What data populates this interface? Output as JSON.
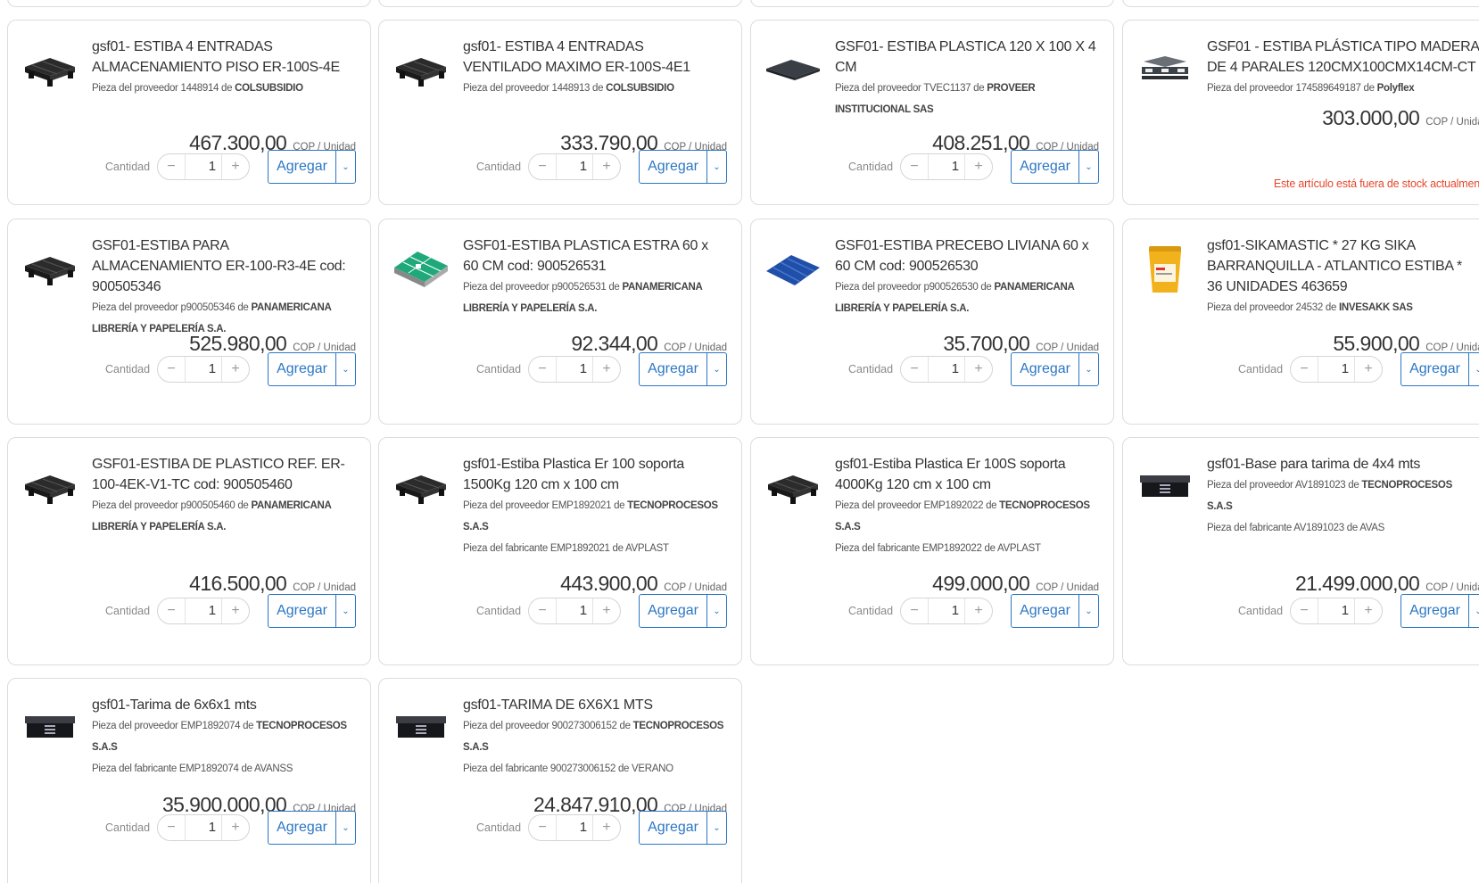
{
  "common": {
    "quantity_label": "Cantidad",
    "add_label": "Agregar",
    "unit_label": "COP / Unidad",
    "minus": "−",
    "plus": "+",
    "chevron": "⌄"
  },
  "colors": {
    "accent": "#2b77c4",
    "out_of_stock": "#e5472b",
    "border": "#dcdcdc"
  },
  "products": [
    {
      "title": "gsf01- ESTIBA 4 ENTRADAS ALMACENAMIENTO PISO ER-100S-4E",
      "supplier_prefix": "Pieza del proveedor 1448914 de",
      "supplier_name": "COLSUBSIDIO",
      "price": "467.300,00",
      "quantity": "1",
      "icon": "black-pallet-icon"
    },
    {
      "title": "gsf01- ESTIBA 4 ENTRADAS VENTILADO MAXIMO ER-100S-4E1",
      "supplier_prefix": "Pieza del proveedor 1448913 de",
      "supplier_name": "COLSUBSIDIO",
      "price": "333.790,00",
      "quantity": "1",
      "icon": "black-pallet-icon"
    },
    {
      "title": "GSF01- ESTIBA PLASTICA 120 X 100 X 4 CM",
      "supplier_prefix": "Pieza del proveedor TVEC1137 de",
      "supplier_name": "PROVEER INSTITUCIONAL SAS",
      "price": "408.251,00",
      "quantity": "1",
      "icon": "flat-board-icon"
    },
    {
      "title": "GSF01 - ESTIBA PLÁSTICA TIPO MADERA DE 4 PARALES 120CMX100CMX14CM-CT",
      "supplier_prefix": "Pieza del proveedor 174589649187 de",
      "supplier_name": "Polyflex",
      "price": "303.000,00",
      "out_of_stock": "Este artículo está fuera de stock actualmente",
      "icon": "slatted-pallet-icon"
    },
    {
      "title": "GSF01-ESTIBA PARA ALMACENAMIENTO ER-100-R3-4E cod: 900505346",
      "supplier_prefix": "Pieza del proveedor p900505346 de",
      "supplier_name": "PANAMERICANA LIBRERÍA Y PAPELERÍA S.A.",
      "price": "525.980,00",
      "quantity": "1",
      "icon": "black-pallet-icon"
    },
    {
      "title": "GSF01-ESTIBA PLASTICA ESTRA 60 x 60 CM cod: 900526531",
      "supplier_prefix": "Pieza del proveedor p900526531 de",
      "supplier_name": "PANAMERICANA LIBRERÍA Y PAPELERÍA S.A.",
      "price": "92.344,00",
      "quantity": "1",
      "icon": "green-pallet-icon"
    },
    {
      "title": "GSF01-ESTIBA PRECEBO LIVIANA 60 x 60 CM cod: 900526530",
      "supplier_prefix": "Pieza del proveedor p900526530 de",
      "supplier_name": "PANAMERICANA LIBRERÍA Y PAPELERÍA S.A.",
      "price": "35.700,00",
      "quantity": "1",
      "icon": "blue-pallet-icon"
    },
    {
      "title": "gsf01-SIKAMASTIC * 27 KG SIKA BARRANQUILLA - ATLANTICO ESTIBA * 36 UNIDADES 463659",
      "supplier_prefix": "Pieza del proveedor 24532 de",
      "supplier_name": "INVESAKK SAS",
      "price": "55.900,00",
      "quantity": "1",
      "icon": "yellow-bucket-icon"
    },
    {
      "title": "GSF01-ESTIBA DE PLASTICO REF. ER-100-4EK-V1-TC cod: 900505460",
      "supplier_prefix": "Pieza del proveedor p900505460 de",
      "supplier_name": "PANAMERICANA LIBRERÍA Y PAPELERÍA S.A.",
      "price": "416.500,00",
      "quantity": "1",
      "icon": "black-pallet-icon"
    },
    {
      "title": "gsf01-Estiba Plastica Er 100 soporta 1500Kg 120 cm x 100 cm",
      "supplier_prefix": "Pieza del proveedor EMP1892021 de",
      "supplier_name": "TECNOPROCESOS S.A.S",
      "maker_prefix": "Pieza del fabricante EMP1892021 de",
      "maker_name": "AVPLAST",
      "price": "443.900,00",
      "quantity": "1",
      "icon": "black-pallet-icon"
    },
    {
      "title": "gsf01-Estiba Plastica Er 100S soporta 4000Kg 120 cm x 100 cm",
      "supplier_prefix": "Pieza del proveedor EMP1892022 de",
      "supplier_name": "TECNOPROCESOS S.A.S",
      "maker_prefix": "Pieza del fabricante EMP1892022 de",
      "maker_name": "AVPLAST",
      "price": "499.000,00",
      "quantity": "1",
      "icon": "black-pallet-icon"
    },
    {
      "title": "gsf01-Base para tarima de 4x4 mts",
      "supplier_prefix": "Pieza del proveedor AV1891023 de",
      "supplier_name": "TECNOPROCESOS S.A.S",
      "maker_prefix": "Pieza del fabricante AV1891023 de",
      "maker_name": "AVAS",
      "price": "21.499.000,00",
      "quantity": "1",
      "icon": "stage-platform-icon"
    },
    {
      "title": "gsf01-Tarima de 6x6x1 mts",
      "supplier_prefix": "Pieza del proveedor EMP1892074 de",
      "supplier_name": "TECNOPROCESOS S.A.S",
      "maker_prefix": "Pieza del fabricante EMP1892074 de",
      "maker_name": "AVANSS",
      "price": "35.900.000,00",
      "quantity": "1",
      "icon": "stage-platform-icon"
    },
    {
      "title": "gsf01-TARIMA DE 6X6X1 MTS",
      "supplier_prefix": "Pieza del proveedor 900273006152 de",
      "supplier_name": "TECNOPROCESOS S.A.S",
      "maker_prefix": "Pieza del fabricante 900273006152 de",
      "maker_name": "VERANO",
      "price": "24.847.910,00",
      "quantity": "1",
      "icon": "stage-platform-icon"
    }
  ]
}
